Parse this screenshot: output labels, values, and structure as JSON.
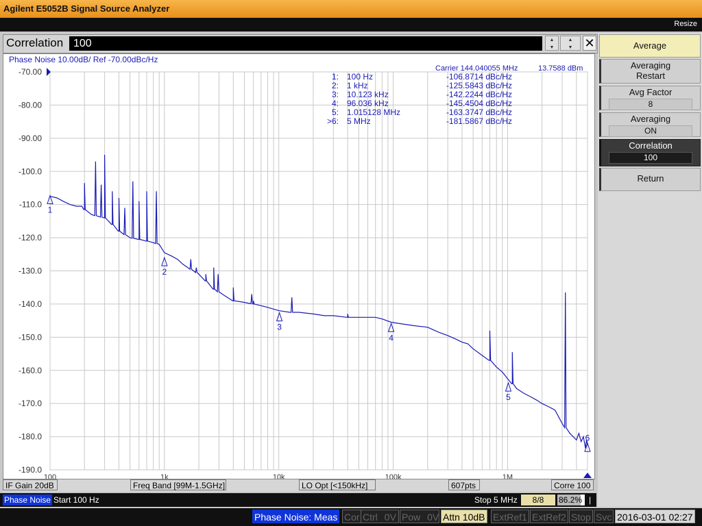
{
  "window": {
    "title": "Agilent E5052B Signal Source Analyzer",
    "resize_label": "Resize"
  },
  "entry": {
    "label": "Correlation",
    "value": "100"
  },
  "graph": {
    "trace_header": "Phase Noise 10.00dB/ Ref -70.00dBc/Hz",
    "carrier": "Carrier 144.040055 MHz",
    "power": "13.7588 dBm",
    "y_ticks": [
      "-70.00",
      "-80.00",
      "-90.00",
      "-100.0",
      "-110.0",
      "-120.0",
      "-130.0",
      "-140.0",
      "-150.0",
      "-160.0",
      "-170.0",
      "-180.0",
      "-190.0"
    ],
    "x_ticks": [
      "100",
      "1k",
      "10k",
      "100k",
      "1M"
    ],
    "markers": [
      {
        "id": "1:",
        "freq": "100 Hz",
        "value": "-106.8714 dBc/Hz"
      },
      {
        "id": "2:",
        "freq": "1 kHz",
        "value": "-125.5843 dBc/Hz"
      },
      {
        "id": "3:",
        "freq": "10.123 kHz",
        "value": "-142.2244 dBc/Hz"
      },
      {
        "id": "4:",
        "freq": "96.036 kHz",
        "value": "-145.4504 dBc/Hz"
      },
      {
        "id": "5:",
        "freq": "1.015128 MHz",
        "value": "-163.3747 dBc/Hz"
      },
      {
        "id": ">6:",
        "freq": "5 MHz",
        "value": "-181.5867 dBc/Hz"
      }
    ],
    "marker_labels": [
      "1",
      "2",
      "3",
      "4",
      "5",
      "6"
    ]
  },
  "status": {
    "if_gain": "IF Gain 20dB",
    "freq_band": "Freq Band [99M-1.5GHz]",
    "lo_opt": "LO Opt [<150kHz]",
    "points": "607pts",
    "corre": "Corre 100"
  },
  "bottom": {
    "meas": "Phase Noise",
    "start": "Start 100 Hz",
    "stop": "Stop 5 MHz",
    "count": "8/8",
    "progress_text": "86.2%",
    "progress": 0.862,
    "end_mark": "|"
  },
  "instrument": {
    "mode": "Phase Noise: Meas",
    "cor": "Cor",
    "ctrl": "Ctrl",
    "ctrl_v": "0V",
    "pow": "Pow",
    "pow_v": "0V",
    "attn": "Attn 10dB",
    "extref1": "ExtRef1",
    "extref2": "ExtRef2",
    "stop": "Stop",
    "svc": "Svc",
    "datetime": "2016-03-01 02:27"
  },
  "softkeys": [
    {
      "label": "Average"
    },
    {
      "label": "Averaging",
      "sub": "Restart"
    },
    {
      "label": "Avg Factor",
      "value": "8"
    },
    {
      "label": "Averaging",
      "value": "ON"
    },
    {
      "label": "Correlation",
      "value": "100"
    },
    {
      "label": "Return"
    }
  ],
  "chart_data": {
    "type": "line",
    "title": "Phase Noise 10.00dB/ Ref -70.00dBc/Hz",
    "xscale": "log",
    "xlim": [
      100,
      5000000
    ],
    "ylim": [
      -190,
      -70
    ],
    "series": [
      {
        "color": "#1a1ab5",
        "x": [
          100,
          115,
          130,
          150,
          170,
          190,
          200,
          230,
          260,
          300,
          350,
          400,
          500,
          600,
          700,
          800,
          900,
          1000,
          1150,
          1300,
          1450,
          1600,
          1800,
          2000,
          2300,
          2700,
          3200,
          4000,
          5000,
          6000,
          7000,
          8000,
          10000,
          12500,
          15000,
          20000,
          25000,
          30000,
          40000,
          50000,
          60000,
          70000,
          80000,
          96000,
          120000,
          150000,
          200000,
          250000,
          300000,
          350000,
          400000,
          450000,
          500000,
          600000,
          700000,
          800000,
          900000,
          1000000,
          1100000,
          1200000,
          1400000,
          1600000,
          1800000,
          2000000,
          2300000,
          2600000,
          3000000,
          3500000,
          4000000,
          4500000,
          5000000
        ],
        "y": [
          -107.5,
          -108,
          -109,
          -110,
          -110.5,
          -110.5,
          -111.5,
          -113,
          -113.5,
          -114,
          -116,
          -118,
          -120,
          -120.5,
          -121,
          -121.5,
          -122,
          -124.5,
          -125.5,
          -126.5,
          -128,
          -129,
          -130,
          -131,
          -133,
          -135.5,
          -137,
          -139,
          -139.5,
          -140,
          -140.5,
          -141,
          -142,
          -142.5,
          -142.5,
          -143,
          -143.5,
          -143.5,
          -144,
          -144,
          -144,
          -144,
          -144.5,
          -145.5,
          -146,
          -146.5,
          -147,
          -148.5,
          -149.5,
          -150.5,
          -151.5,
          -152,
          -153.5,
          -155.5,
          -157,
          -159,
          -160.5,
          -162.5,
          -164,
          -165.5,
          -167,
          -168,
          -169,
          -170,
          -171,
          -172,
          -176,
          -179,
          -181,
          -182,
          -182.5
        ],
        "spikes": [
          [
            200,
            -103.5
          ],
          [
            250,
            -97
          ],
          [
            280,
            -104
          ],
          [
            300,
            -95
          ],
          [
            350,
            -106
          ],
          [
            400,
            -108
          ],
          [
            450,
            -111
          ],
          [
            530,
            -103
          ],
          [
            600,
            -109
          ],
          [
            700,
            -106
          ],
          [
            850,
            -106
          ],
          [
            1700,
            -126.5
          ],
          [
            1900,
            -129
          ],
          [
            2300,
            -131
          ],
          [
            2700,
            -129
          ],
          [
            2950,
            -131
          ],
          [
            4000,
            -135
          ],
          [
            5800,
            -137
          ],
          [
            6000,
            -139
          ],
          [
            13000,
            -138
          ],
          [
            40000,
            -143
          ],
          [
            700000,
            -148
          ],
          [
            1100000,
            -154.5
          ],
          [
            3200000,
            -136.5
          ]
        ]
      }
    ],
    "markers": [
      {
        "label": "1",
        "x": 100,
        "y": -106.8714
      },
      {
        "label": "2",
        "x": 1000,
        "y": -125.5843
      },
      {
        "label": "3",
        "x": 10123,
        "y": -142.2244
      },
      {
        "label": "4",
        "x": 96036,
        "y": -145.4504
      },
      {
        "label": "5",
        "x": 1015128,
        "y": -163.3747
      },
      {
        "label": "6",
        "x": 5000000,
        "y": -181.5867
      }
    ],
    "grid": true
  }
}
